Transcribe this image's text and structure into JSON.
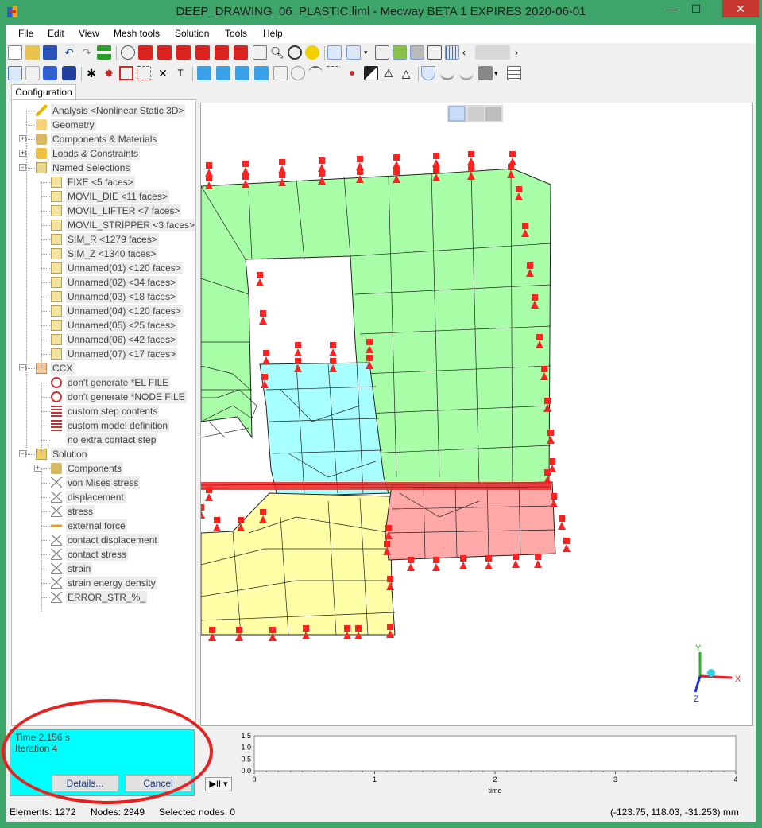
{
  "window": {
    "title": "DEEP_DRAWING_06_PLASTIC.liml - Mecway BETA 1 EXPIRES 2020-06-01",
    "minimize": "—",
    "maximize": "☐",
    "close": "✕"
  },
  "menu": {
    "items": [
      "File",
      "Edit",
      "View",
      "Mesh tools",
      "Solution",
      "Tools",
      "Help"
    ]
  },
  "tabs": {
    "configuration": "Configuration"
  },
  "tree": {
    "items": [
      {
        "label": "Analysis <Nonlinear Static 3D>",
        "icon": "analysis-icon"
      },
      {
        "label": "Geometry",
        "icon": "folder-icon"
      },
      {
        "label": "Components & Materials",
        "icon": "components-icon"
      },
      {
        "label": "Loads & Constraints",
        "icon": "loads-icon"
      },
      {
        "label": "Named Selections",
        "icon": "named-selections-icon"
      },
      {
        "label": "FIXE <5 faces>",
        "icon": "face-selection-icon"
      },
      {
        "label": "MOVIL_DIE <11 faces>",
        "icon": "face-selection-icon"
      },
      {
        "label": "MOVIL_LIFTER <7 faces>",
        "icon": "face-selection-icon"
      },
      {
        "label": "MOVIL_STRIPPER <3 faces>",
        "icon": "face-selection-icon"
      },
      {
        "label": "SIM_R <1279 faces>",
        "icon": "face-selection-icon"
      },
      {
        "label": "SIM_Z <1340 faces>",
        "icon": "face-selection-icon"
      },
      {
        "label": "Unnamed(01) <120 faces>",
        "icon": "face-selection-icon"
      },
      {
        "label": "Unnamed(02) <34 faces>",
        "icon": "face-selection-icon"
      },
      {
        "label": "Unnamed(03) <18 faces>",
        "icon": "face-selection-icon"
      },
      {
        "label": "Unnamed(04) <120 faces>",
        "icon": "face-selection-icon"
      },
      {
        "label": "Unnamed(05) <25 faces>",
        "icon": "face-selection-icon"
      },
      {
        "label": "Unnamed(06) <42 faces>",
        "icon": "face-selection-icon"
      },
      {
        "label": "Unnamed(07) <17 faces>",
        "icon": "face-selection-icon"
      },
      {
        "label": "CCX",
        "icon": "ccx-icon"
      },
      {
        "label": "don't generate *EL FILE",
        "icon": "no-file-icon"
      },
      {
        "label": "don't generate *NODE FILE",
        "icon": "no-file-icon"
      },
      {
        "label": "custom step contents",
        "icon": "custom-ccx-icon"
      },
      {
        "label": "custom model definition",
        "icon": "custom-ccx-icon"
      },
      {
        "label": "no extra contact step",
        "icon": "blank-icon"
      },
      {
        "label": "Solution",
        "icon": "solution-icon"
      },
      {
        "label": "Components",
        "icon": "components-icon"
      },
      {
        "label": "von Mises stress",
        "icon": "result-icon"
      },
      {
        "label": "displacement",
        "icon": "result-icon"
      },
      {
        "label": "stress",
        "icon": "result-icon"
      },
      {
        "label": "external force",
        "icon": "force-arrow-icon"
      },
      {
        "label": "contact displacement",
        "icon": "result-icon"
      },
      {
        "label": "contact stress",
        "icon": "result-icon"
      },
      {
        "label": "strain",
        "icon": "result-icon"
      },
      {
        "label": "strain energy density",
        "icon": "result-icon"
      },
      {
        "label": "ERROR_STR_%_",
        "icon": "result-icon"
      }
    ]
  },
  "solver_status": {
    "time": "Time 2.156 s",
    "iteration": "Iteration 4",
    "details_button": "Details...",
    "cancel_button": "Cancel"
  },
  "progress_chart": {
    "y_ticks": [
      "1.5",
      "1.0",
      "0.5",
      "0.0"
    ],
    "x_ticks": [
      "0",
      "1",
      "2",
      "3",
      "4"
    ],
    "xlabel": "time",
    "play_label": "▶II ▾"
  },
  "statusbar": {
    "elements": "Elements: 1272",
    "nodes": "Nodes: 2949",
    "selected": "Selected nodes: 0",
    "coords": "(-123.75, 118.03, -31.253) mm"
  },
  "axis_triad": {
    "x": "X",
    "y": "Y",
    "z": "Z"
  },
  "colors": {
    "window_frame": "#3da46a",
    "mesh_green": "#a8ffa8",
    "mesh_cyan": "#a8ffff",
    "mesh_yellow": "#ffffa8",
    "mesh_pink": "#ffa8a8",
    "constraint_red": "#ff2020",
    "status_cyan": "#00ffff",
    "highlight_ellipse": "#e8211f"
  }
}
